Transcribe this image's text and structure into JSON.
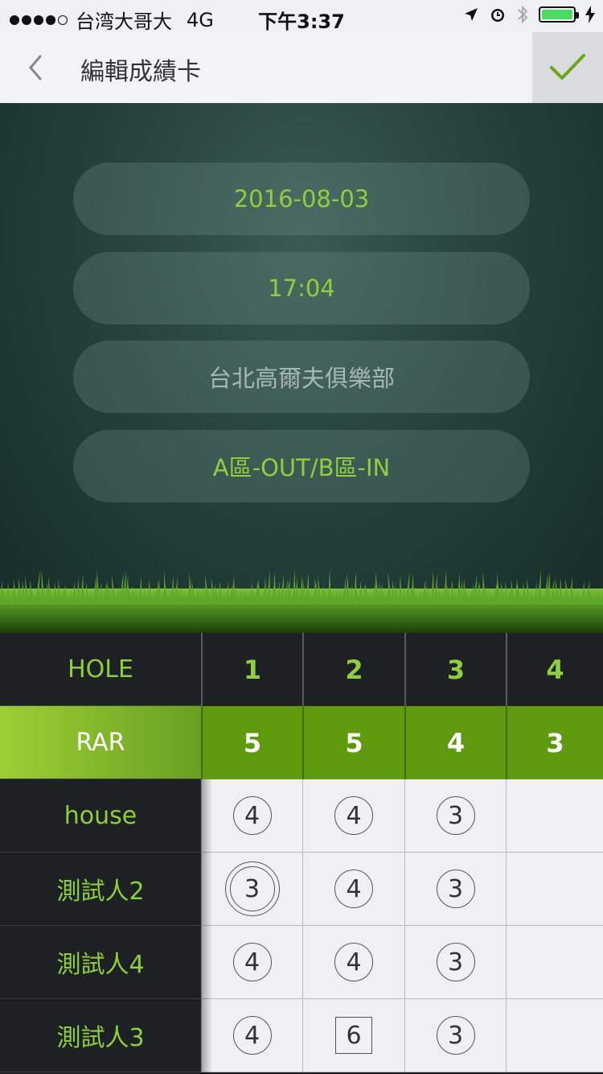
{
  "status_bar": {
    "carrier": "台湾大哥大",
    "network": "4G",
    "time": "下午3:37",
    "icons": [
      "location-icon",
      "alarm-icon",
      "bluetooth-icon",
      "battery-icon",
      "charging-icon"
    ]
  },
  "nav": {
    "title": "編輯成績卡",
    "back_icon": "chevron-left-icon",
    "confirm_icon": "checkmark-icon"
  },
  "form": {
    "date": "2016-08-03",
    "time": "17:04",
    "course": "台北高爾夫俱樂部",
    "zone": "A區-OUT/B區-IN"
  },
  "scorecard": {
    "hole_label": "HOLE",
    "par_label": "RAR",
    "holes": [
      "1",
      "2",
      "3",
      "4"
    ],
    "pars": [
      "5",
      "5",
      "4",
      "3"
    ],
    "players": [
      {
        "name": "house",
        "scores": [
          {
            "v": "4",
            "mark": "circle"
          },
          {
            "v": "4",
            "mark": "circle"
          },
          {
            "v": "3",
            "mark": "circle"
          },
          {
            "v": "",
            "mark": "none"
          }
        ]
      },
      {
        "name": "測試人2",
        "scores": [
          {
            "v": "3",
            "mark": "double-circle"
          },
          {
            "v": "4",
            "mark": "circle"
          },
          {
            "v": "3",
            "mark": "circle"
          },
          {
            "v": "",
            "mark": "none"
          }
        ]
      },
      {
        "name": "測試人4",
        "scores": [
          {
            "v": "4",
            "mark": "circle"
          },
          {
            "v": "4",
            "mark": "circle"
          },
          {
            "v": "3",
            "mark": "circle"
          },
          {
            "v": "",
            "mark": "none"
          }
        ]
      },
      {
        "name": "測試人3",
        "scores": [
          {
            "v": "4",
            "mark": "circle"
          },
          {
            "v": "6",
            "mark": "square"
          },
          {
            "v": "3",
            "mark": "circle"
          },
          {
            "v": "",
            "mark": "none"
          }
        ]
      }
    ]
  },
  "colors": {
    "accent": "#8fcf3f",
    "par_bg": "#5f9a0e",
    "battery": "#4cd964"
  }
}
